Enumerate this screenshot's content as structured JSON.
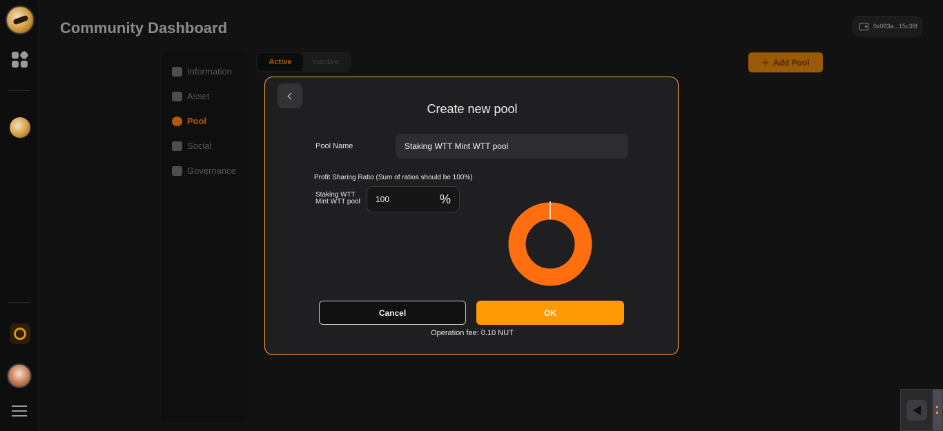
{
  "header": {
    "title": "Community Dashboard",
    "wallet_address": "0x083a...15c38f"
  },
  "sidenav": {
    "items": [
      {
        "label": "Information",
        "icon": "home-icon"
      },
      {
        "label": "Asset",
        "icon": "chart-icon"
      },
      {
        "label": "Pool",
        "icon": "pool-icon"
      },
      {
        "label": "Social",
        "icon": "social-icon"
      },
      {
        "label": "Governance",
        "icon": "bulb-icon"
      }
    ],
    "active": "Pool"
  },
  "tabs": [
    {
      "label": "Active"
    },
    {
      "label": "Inactive"
    }
  ],
  "add_pool_label": "Add Pool",
  "modal": {
    "title": "Create new pool",
    "pool_name_label": "Pool Name",
    "pool_name_value": "Staking WTT Mint WTT pool",
    "ratio_label": "Profit Sharing Ratio (Sum of ratios should be 100%)",
    "ratio_pool_label": "Staking WTT Mint WTT pool",
    "ratio_value": "100",
    "ratio_unit": "%",
    "cancel_label": "Cancel",
    "ok_label": "OK",
    "fee_text": "Operation fee: 0.10 NUT"
  },
  "colors": {
    "accent": "#ff9a05",
    "donut": "#ff6f0f",
    "modal_border": "#f5a64a"
  },
  "donut": {
    "slices": [
      {
        "name": "Staking WTT Mint WTT pool",
        "percent": 100
      }
    ]
  }
}
